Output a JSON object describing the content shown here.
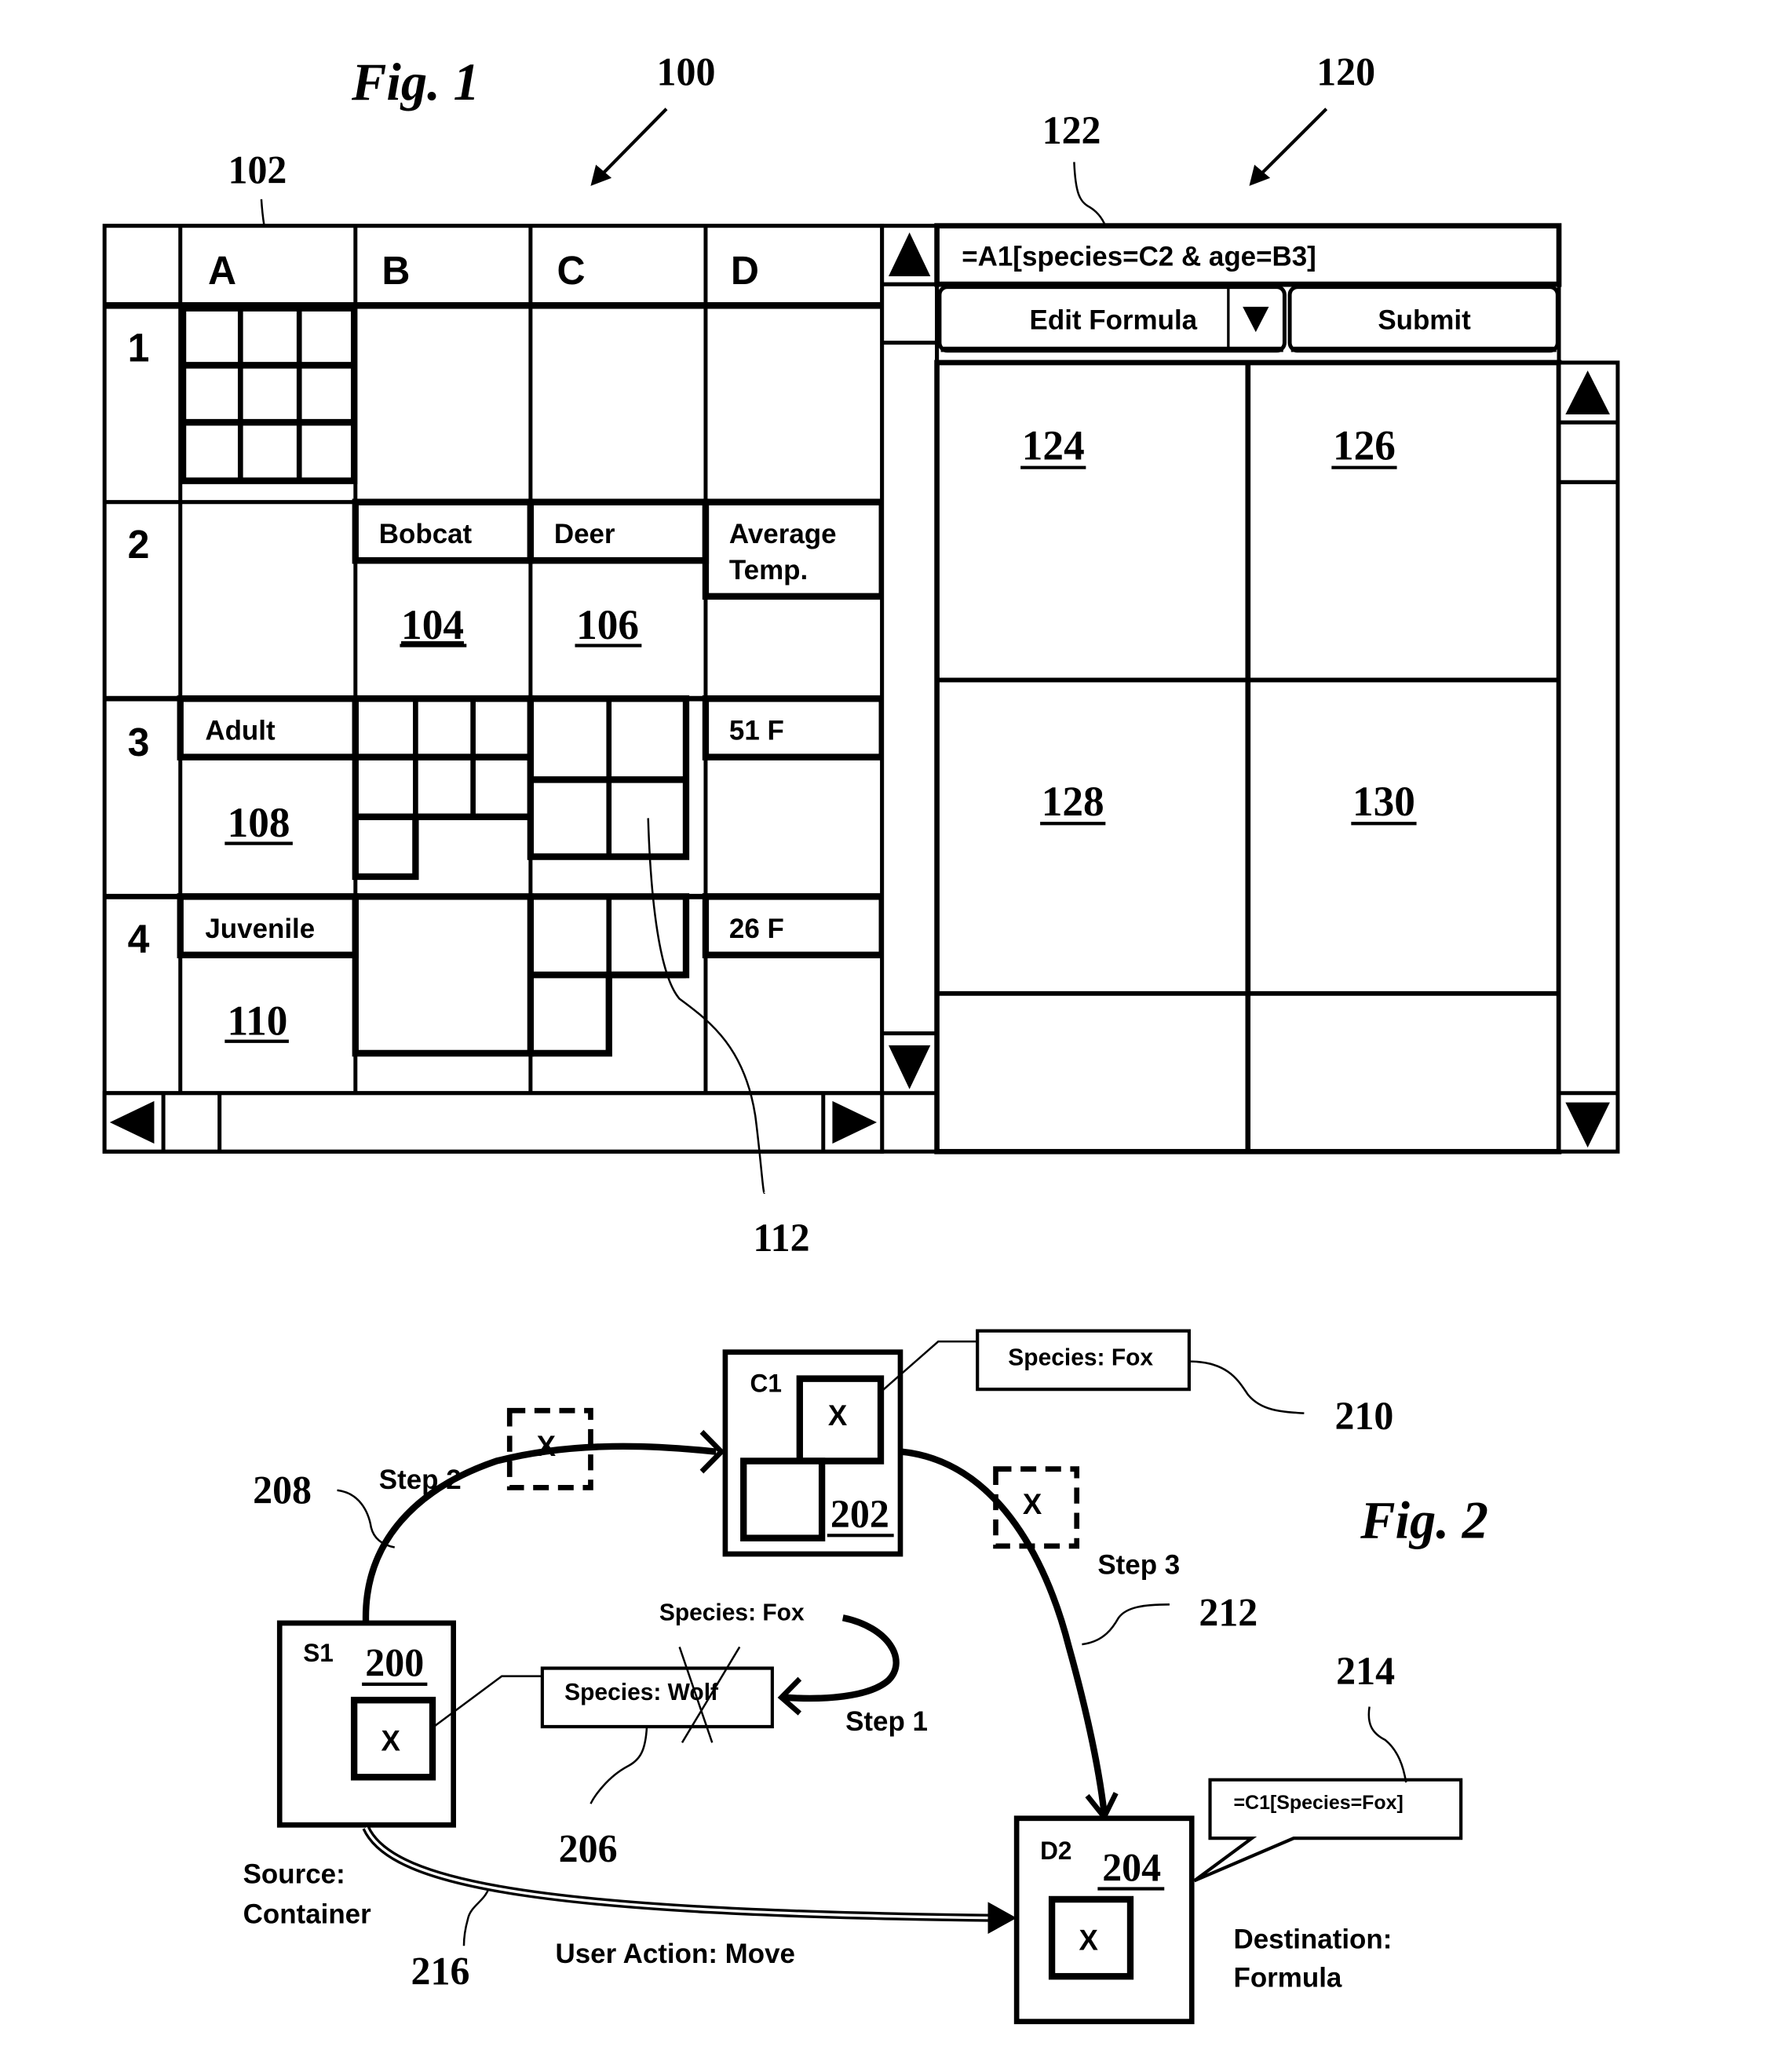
{
  "figure1": {
    "title": "Fig. 1",
    "refs": {
      "spreadsheet": "100",
      "nested_grid": "102",
      "bobcat_cell": "104",
      "deer_cell": "106",
      "adult_cell": "108",
      "juvenile_cell": "110",
      "nested_cell": "112",
      "panel": "120",
      "formula_bar": "122",
      "panel_cell_1": "124",
      "panel_cell_2": "126",
      "panel_cell_3": "128",
      "panel_cell_4": "130"
    },
    "spreadsheet": {
      "columns": [
        "A",
        "B",
        "C",
        "D"
      ],
      "rows": [
        "1",
        "2",
        "3",
        "4"
      ],
      "cells": {
        "B2": "Bobcat",
        "C2": "Deer",
        "D2_line1": "Average",
        "D2_line2": "Temp.",
        "A3": "Adult",
        "D3": "51 F",
        "A4": "Juvenile",
        "D4": "26 F"
      }
    },
    "panel": {
      "formula": "=A1[species=C2 & age=B3]",
      "edit_formula_label": "Edit Formula",
      "submit_label": "Submit"
    }
  },
  "figure2": {
    "title": "Fig. 2",
    "refs": {
      "source": "200",
      "container": "202",
      "destination": "204",
      "wolf_label": "206",
      "step2_path": "208",
      "fox_label": "210",
      "step3_path": "212",
      "formula_callout": "214",
      "move_path": "216"
    },
    "nodes": {
      "source_id": "S1",
      "container_id": "C1",
      "destination_id": "D2",
      "item_mark": "X"
    },
    "labels": {
      "species_fox": "Species: Fox",
      "species_wolf": "Species: Wolf",
      "species_fox_new": "Species: Fox",
      "step1": "Step 1",
      "step2": "Step 2",
      "step3": "Step 3",
      "formula": "=C1[Species=Fox]",
      "source_line1": "Source:",
      "source_line2": "Container",
      "destination_line1": "Destination:",
      "destination_line2": "Formula",
      "user_action": "User Action: Move"
    }
  }
}
